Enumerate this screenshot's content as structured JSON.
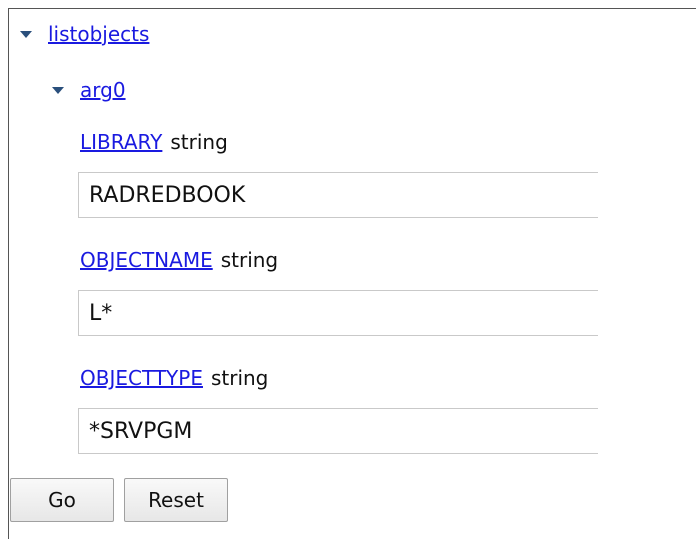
{
  "tree": {
    "operation": "listobjects",
    "argument": "arg0"
  },
  "fields": [
    {
      "name": "LIBRARY",
      "type": "string",
      "value": "RADREDBOOK"
    },
    {
      "name": "OBJECTNAME",
      "type": "string",
      "value": "L*"
    },
    {
      "name": "OBJECTTYPE",
      "type": "string",
      "value": "*SRVPGM"
    }
  ],
  "buttons": {
    "go": "Go",
    "reset": "Reset"
  }
}
